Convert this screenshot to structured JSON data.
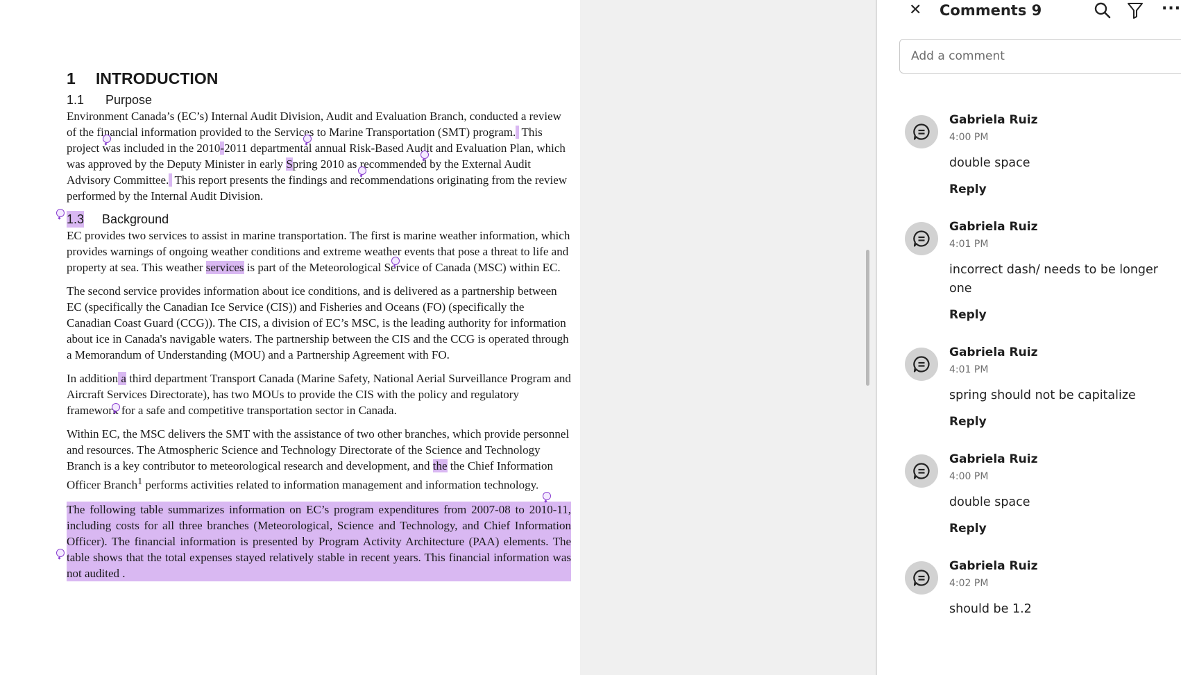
{
  "document": {
    "heading1": {
      "number": "1",
      "title": "INTRODUCTION"
    },
    "section_purpose": {
      "number": "1.1",
      "title": "Purpose"
    },
    "purpose_text": {
      "s1": "Environment Canada’s (EC’s) Internal Audit Division, Audit and Evaluation Branch, conducted a review of the financial information provided to the Services to Marine Transportation (SMT) program.",
      "s2a": " This project was included in the 2010",
      "dash": "-",
      "s2b": "2011 departmental annual Risk-Based Audit and Evaluation Plan, which was approved by the Deputy Minister in early ",
      "S": "S",
      "s2c": "pring 2010 as recommended by the External Audit Advisory Committee.",
      "s3": " This report presents the findings and recommendations originating from the review performed by the Internal Audit Division."
    },
    "section_background": {
      "number": "1.3",
      "title": "Background"
    },
    "bg_p1": {
      "a": "EC provides two services to assist in marine transportation. The first is marine weather information, which provides warnings of ongoing weather conditions and extreme weather events that pose a threat to life and property at sea. This weather ",
      "hl": "services",
      "b": " is part of the Meteorological Service of Canada (MSC) within EC."
    },
    "bg_p2": "The second service provides information about ice conditions, and is delivered as a partnership between EC (specifically the Canadian Ice Service (CIS)) and Fisheries and Oceans (FO) (specifically the Canadian Coast Guard (CCG)). The CIS, a division of EC’s MSC, is the leading authority for information about ice in Canada's navigable waters. The partnership between the CIS and the CCG is operated through a Memorandum of Understanding (MOU) and a Partnership Agreement with FO.",
    "bg_p3": {
      "a": "In addition",
      "hl": " a",
      "b": " third department Transport Canada (Marine Safety, National Aerial Surveillance Program and Aircraft Services Directorate), has two MOUs to provide the CIS with the policy and regulatory framework for a safe and competitive transportation sector in Canada."
    },
    "bg_p4": {
      "a": "Within EC, the MSC delivers the SMT with the assistance of two other branches, which provide personnel and resources. The Atmospheric Science and Technology Directorate of the Science and Technology Branch is a key contributor to meteorological research and development, and ",
      "hl": "the",
      "b": " the Chief Information Officer Branch",
      "sup": "1",
      "c": " performs activities related to information management and information technology."
    },
    "bg_p5": "The following table summarizes information on EC’s program expenditures from 2007-08 to 2010-11, including costs for all three branches (Meteorological, Science and Technology, and Chief Information Officer). The financial information is presented by Program Activity Architecture (PAA) elements. The table shows that the total expenses stayed relatively stable in recent years. This financial information was not audited ."
  },
  "comments_panel": {
    "title": "Comments 9",
    "close_icon": "close-icon",
    "add_placeholder": "Add a comment",
    "reply_label": "Reply",
    "items": [
      {
        "author": "Gabriela Ruiz",
        "time": "4:00 PM",
        "text": "double space"
      },
      {
        "author": "Gabriela Ruiz",
        "time": "4:01 PM",
        "text": "incorrect dash/ needs to be longer one"
      },
      {
        "author": "Gabriela Ruiz",
        "time": "4:01 PM",
        "text": "spring should not be capitalize"
      },
      {
        "author": "Gabriela Ruiz",
        "time": "4:00 PM",
        "text": "double space"
      },
      {
        "author": "Gabriela Ruiz",
        "time": "4:02 PM",
        "text": "should be 1.2"
      }
    ]
  },
  "colors": {
    "highlight": "#d9b8f2",
    "pin": "#8a3fd1"
  }
}
